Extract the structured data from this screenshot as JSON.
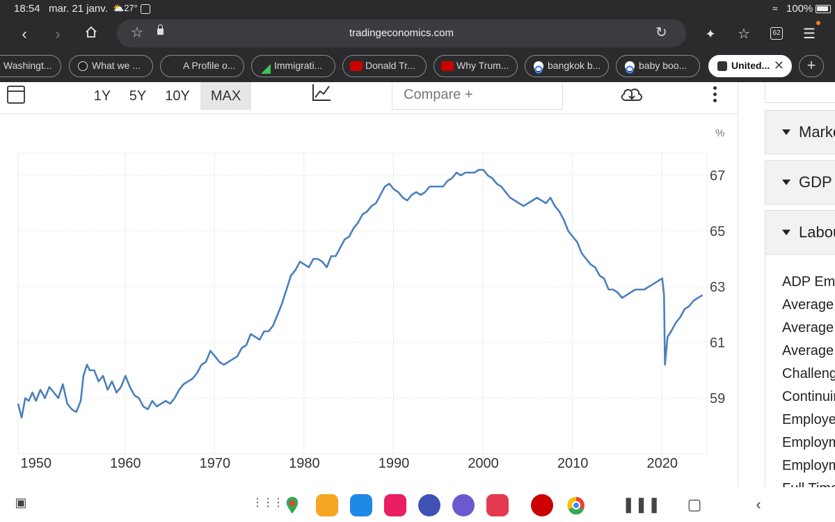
{
  "status_bar": {
    "time": "18:54",
    "date": "mar. 21 janv.",
    "weather": "27°",
    "battery": "100%"
  },
  "browser": {
    "url": "tradingeconomics.com",
    "tab_count": "62",
    "tabs": [
      {
        "label": "Washingt...",
        "icon": "news-favicon"
      },
      {
        "label": "What we ...",
        "icon": "sun-favicon"
      },
      {
        "label": "A Profile o...",
        "icon": "site-favicon"
      },
      {
        "label": "Immigrati...",
        "icon": "triangle-favicon"
      },
      {
        "label": "Donald Tr...",
        "icon": "cnn-favicon"
      },
      {
        "label": "Why Trum...",
        "icon": "cnn-favicon"
      },
      {
        "label": "bangkok b...",
        "icon": "google-favicon"
      },
      {
        "label": "baby boo...",
        "icon": "google-favicon"
      },
      {
        "label": "United...",
        "icon": "te-favicon",
        "active": true
      }
    ]
  },
  "chart_toolbar": {
    "ranges": [
      "1Y",
      "5Y",
      "10Y",
      "MAX"
    ],
    "selected_range": "MAX",
    "compare_label": "Compare +"
  },
  "chart_data": {
    "type": "line",
    "unit_label": "%",
    "color": "#4b7fbd",
    "xlim": [
      1948,
      2025
    ],
    "ylim": [
      57,
      67.8
    ],
    "yticks": [
      59,
      61,
      63,
      65,
      67
    ],
    "xticks": [
      1950,
      1960,
      1970,
      1980,
      1990,
      2000,
      2010,
      2020
    ],
    "x": [
      1948.0,
      1948.4,
      1948.8,
      1949.2,
      1949.6,
      1950.0,
      1950.5,
      1951.0,
      1951.5,
      1952.0,
      1952.5,
      1953.0,
      1953.5,
      1954.0,
      1954.5,
      1955.0,
      1955.3,
      1955.7,
      1956.0,
      1956.5,
      1957.0,
      1957.5,
      1958.0,
      1958.5,
      1959.0,
      1959.5,
      1960.0,
      1960.5,
      1961.0,
      1961.5,
      1962.0,
      1962.5,
      1963.0,
      1963.5,
      1964.0,
      1964.5,
      1965.0,
      1965.5,
      1966.0,
      1966.5,
      1967.0,
      1967.5,
      1968.0,
      1968.5,
      1969.0,
      1969.5,
      1970.0,
      1970.5,
      1971.0,
      1971.5,
      1972.0,
      1972.5,
      1973.0,
      1973.5,
      1974.0,
      1974.5,
      1975.0,
      1975.5,
      1976.0,
      1976.5,
      1977.0,
      1977.5,
      1978.0,
      1978.5,
      1979.0,
      1979.5,
      1980.0,
      1980.5,
      1981.0,
      1981.5,
      1982.0,
      1982.5,
      1983.0,
      1983.5,
      1984.0,
      1984.5,
      1985.0,
      1985.5,
      1986.0,
      1986.5,
      1987.0,
      1987.5,
      1988.0,
      1988.5,
      1989.0,
      1989.5,
      1990.0,
      1990.5,
      1991.0,
      1991.5,
      1992.0,
      1992.5,
      1993.0,
      1993.5,
      1994.0,
      1994.5,
      1995.0,
      1995.5,
      1996.0,
      1996.5,
      1997.0,
      1997.5,
      1998.0,
      1998.5,
      1999.0,
      1999.5,
      2000.0,
      2000.5,
      2001.0,
      2001.5,
      2002.0,
      2002.5,
      2003.0,
      2003.5,
      2004.0,
      2004.5,
      2005.0,
      2005.5,
      2006.0,
      2006.5,
      2007.0,
      2007.5,
      2008.0,
      2008.5,
      2009.0,
      2009.5,
      2010.0,
      2010.5,
      2011.0,
      2011.5,
      2012.0,
      2012.5,
      2013.0,
      2013.5,
      2014.0,
      2014.5,
      2015.0,
      2015.5,
      2016.0,
      2016.5,
      2017.0,
      2017.5,
      2018.0,
      2018.5,
      2019.0,
      2019.5,
      2020.0,
      2020.2,
      2020.3,
      2020.6,
      2021.0,
      2021.5,
      2022.0,
      2022.5,
      2023.0,
      2023.5,
      2024.0,
      2024.5
    ],
    "y": [
      58.8,
      58.3,
      59.0,
      58.9,
      59.2,
      58.9,
      59.3,
      59.0,
      59.4,
      59.2,
      59.0,
      59.5,
      58.8,
      58.6,
      58.5,
      58.9,
      59.8,
      60.2,
      60.0,
      60.0,
      59.6,
      59.8,
      59.3,
      59.6,
      59.2,
      59.4,
      59.8,
      59.4,
      59.1,
      59.0,
      58.7,
      58.6,
      58.9,
      58.7,
      58.8,
      58.9,
      58.8,
      59.0,
      59.3,
      59.5,
      59.6,
      59.7,
      59.9,
      60.2,
      60.3,
      60.7,
      60.5,
      60.3,
      60.2,
      60.3,
      60.4,
      60.5,
      60.8,
      60.9,
      61.3,
      61.2,
      61.1,
      61.4,
      61.4,
      61.6,
      62.0,
      62.4,
      62.9,
      63.4,
      63.6,
      63.9,
      63.8,
      63.7,
      64.0,
      64.0,
      63.9,
      63.7,
      64.1,
      64.1,
      64.4,
      64.7,
      64.8,
      65.1,
      65.3,
      65.6,
      65.7,
      65.9,
      66.0,
      66.3,
      66.6,
      66.7,
      66.5,
      66.4,
      66.2,
      66.1,
      66.3,
      66.4,
      66.3,
      66.4,
      66.6,
      66.6,
      66.6,
      66.6,
      66.8,
      66.9,
      67.1,
      67.0,
      67.1,
      67.1,
      67.1,
      67.2,
      67.2,
      67.0,
      66.9,
      66.7,
      66.6,
      66.4,
      66.2,
      66.1,
      66.0,
      65.9,
      66.0,
      66.1,
      66.2,
      66.1,
      66.0,
      66.2,
      65.9,
      65.7,
      65.4,
      65.0,
      64.8,
      64.6,
      64.2,
      64.0,
      63.8,
      63.7,
      63.4,
      63.3,
      62.9,
      62.9,
      62.8,
      62.6,
      62.7,
      62.8,
      62.9,
      62.9,
      62.9,
      63.0,
      63.1,
      63.2,
      63.3,
      62.7,
      60.2,
      61.2,
      61.4,
      61.7,
      61.9,
      62.2,
      62.3,
      62.5,
      62.6,
      62.7
    ]
  },
  "right_panel": {
    "sections": [
      "Markets",
      "GDP",
      "Labour"
    ],
    "items": [
      "ADP Employment Change",
      "Average Hourly Earnings",
      "Average Weekly Hours",
      "Average Hourly Earnings YoY",
      "Challenger Job Cuts",
      "Continuing Jobless Claims",
      "Employed Persons",
      "Employment Cost Index",
      "Employment Rate",
      "Full Time Employment"
    ]
  },
  "navbar": {
    "apps": [
      {
        "name": "maps",
        "color": "#ffffff"
      },
      {
        "name": "files",
        "color": "#f5a623"
      },
      {
        "name": "navigation",
        "color": "#1e88e5"
      },
      {
        "name": "flower",
        "color": "#e91e63"
      },
      {
        "name": "settings",
        "color": "#3f51b5"
      },
      {
        "name": "internet",
        "color": "#6a5acd"
      },
      {
        "name": "camera",
        "color": "#e53950"
      },
      {
        "name": "cnn",
        "color": "#cc0000"
      },
      {
        "name": "chrome",
        "color": "#ffffff"
      }
    ]
  }
}
